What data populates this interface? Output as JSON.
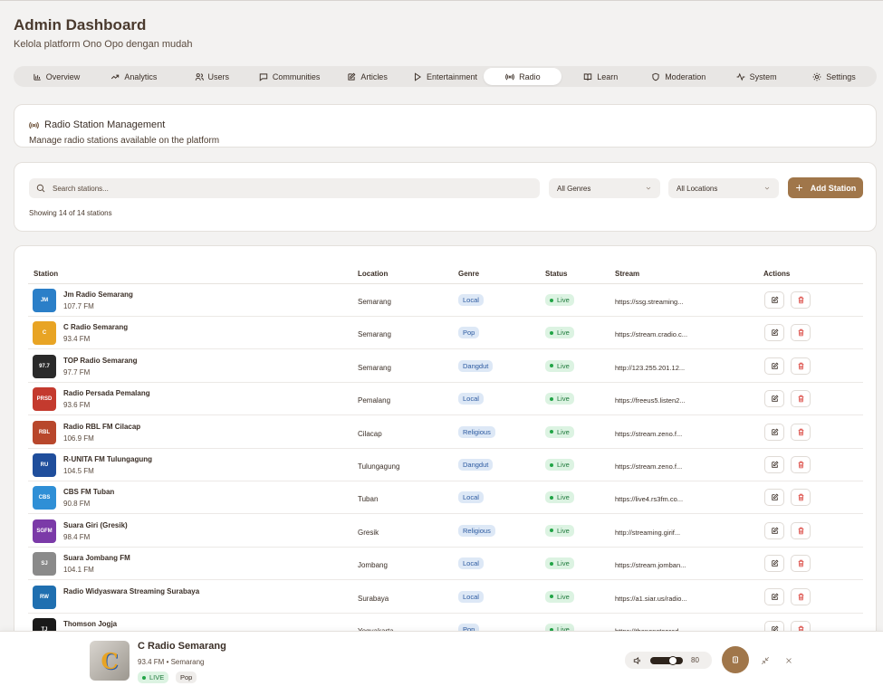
{
  "header": {
    "title": "Admin Dashboard",
    "subtitle": "Kelola platform Ono Opo dengan mudah"
  },
  "tabs": [
    {
      "label": "Overview",
      "icon": "bar-chart-icon"
    },
    {
      "label": "Analytics",
      "icon": "trending-up-icon"
    },
    {
      "label": "Users",
      "icon": "users-icon"
    },
    {
      "label": "Communities",
      "icon": "message-square-icon"
    },
    {
      "label": "Articles",
      "icon": "edit-icon"
    },
    {
      "label": "Entertainment",
      "icon": "play-icon"
    },
    {
      "label": "Radio",
      "icon": "radio-icon",
      "active": true
    },
    {
      "label": "Learn",
      "icon": "book-open-icon"
    },
    {
      "label": "Moderation",
      "icon": "shield-icon"
    },
    {
      "label": "System",
      "icon": "activity-icon"
    },
    {
      "label": "Settings",
      "icon": "gear-icon"
    }
  ],
  "section": {
    "title": "Radio Station Management",
    "description": "Manage radio stations available on the platform"
  },
  "filters": {
    "search_placeholder": "Search stations...",
    "genre": "All Genres",
    "location": "All Locations",
    "add_label": "Add Station",
    "showing": "Showing 14 of 14 stations"
  },
  "table": {
    "columns": [
      "Station",
      "Location",
      "Genre",
      "Status",
      "Stream",
      "Actions"
    ],
    "rows": [
      {
        "name": "Jm Radio Semarang",
        "freq": "107.7 FM",
        "location": "Semarang",
        "genre": "Local",
        "status": "Live",
        "stream": "https://ssg.streaming...",
        "logo_color": "#2b7fc8",
        "logo_text": "JM"
      },
      {
        "name": "C Radio Semarang",
        "freq": "93.4 FM",
        "location": "Semarang",
        "genre": "Pop",
        "status": "Live",
        "stream": "https://stream.cradio.c...",
        "logo_color": "#e8a424",
        "logo_text": "C"
      },
      {
        "name": "TOP Radio Semarang",
        "freq": "97.7 FM",
        "location": "Semarang",
        "genre": "Dangdut",
        "status": "Live",
        "stream": "http://123.255.201.12...",
        "logo_color": "#2a2a2a",
        "logo_text": "97.7"
      },
      {
        "name": "Radio Persada Pemalang",
        "freq": "93.6 FM",
        "location": "Pemalang",
        "genre": "Local",
        "status": "Live",
        "stream": "https://freeus5.listen2...",
        "logo_color": "#c43a2e",
        "logo_text": "PRSD"
      },
      {
        "name": "Radio RBL FM Cilacap",
        "freq": "106.9 FM",
        "location": "Cilacap",
        "genre": "Religious",
        "status": "Live",
        "stream": "https://stream.zeno.f...",
        "logo_color": "#b8472c",
        "logo_text": "RBL"
      },
      {
        "name": "R-UNITA FM Tulungagung",
        "freq": "104.5 FM",
        "location": "Tulungagung",
        "genre": "Dangdut",
        "status": "Live",
        "stream": "https://stream.zeno.f...",
        "logo_color": "#1f4e9c",
        "logo_text": "RU"
      },
      {
        "name": "CBS FM Tuban",
        "freq": "90.8 FM",
        "location": "Tuban",
        "genre": "Local",
        "status": "Live",
        "stream": "https://live4.rs3fm.co...",
        "logo_color": "#2f8fd6",
        "logo_text": "CBS"
      },
      {
        "name": "Suara Giri (Gresik)",
        "freq": "98.4 FM",
        "location": "Gresik",
        "genre": "Religious",
        "status": "Live",
        "stream": "http://streaming.girif...",
        "logo_color": "#7b3aa8",
        "logo_text": "SGFM"
      },
      {
        "name": "Suara Jombang FM",
        "freq": "104.1 FM",
        "location": "Jombang",
        "genre": "Local",
        "status": "Live",
        "stream": "https://stream.jomban...",
        "logo_color": "#8a8a8a",
        "logo_text": "SJ"
      },
      {
        "name": "Radio Widyaswara Streaming Surabaya",
        "freq": "",
        "location": "Surabaya",
        "genre": "Local",
        "status": "Live",
        "stream": "https://a1.siar.us/radio...",
        "logo_color": "#1f6fb0",
        "logo_text": "RW"
      },
      {
        "name": "Thomson Jogja",
        "freq": "",
        "location": "Yogyakarta",
        "genre": "Pop",
        "status": "Live",
        "stream": "https://thenonstoprad...",
        "logo_color": "#1a1a1a",
        "logo_text": "TJ"
      }
    ]
  },
  "player": {
    "title": "C Radio Semarang",
    "subtitle": "93.4 FM • Semarang",
    "live": "LIVE",
    "genre": "Pop",
    "volume": "80",
    "volume_fraction": 0.8
  },
  "colors": {
    "accent": "#a0764a",
    "live_bg": "#dcf3e2",
    "genre_bg": "#dde8f6",
    "delete": "#d9413a"
  }
}
